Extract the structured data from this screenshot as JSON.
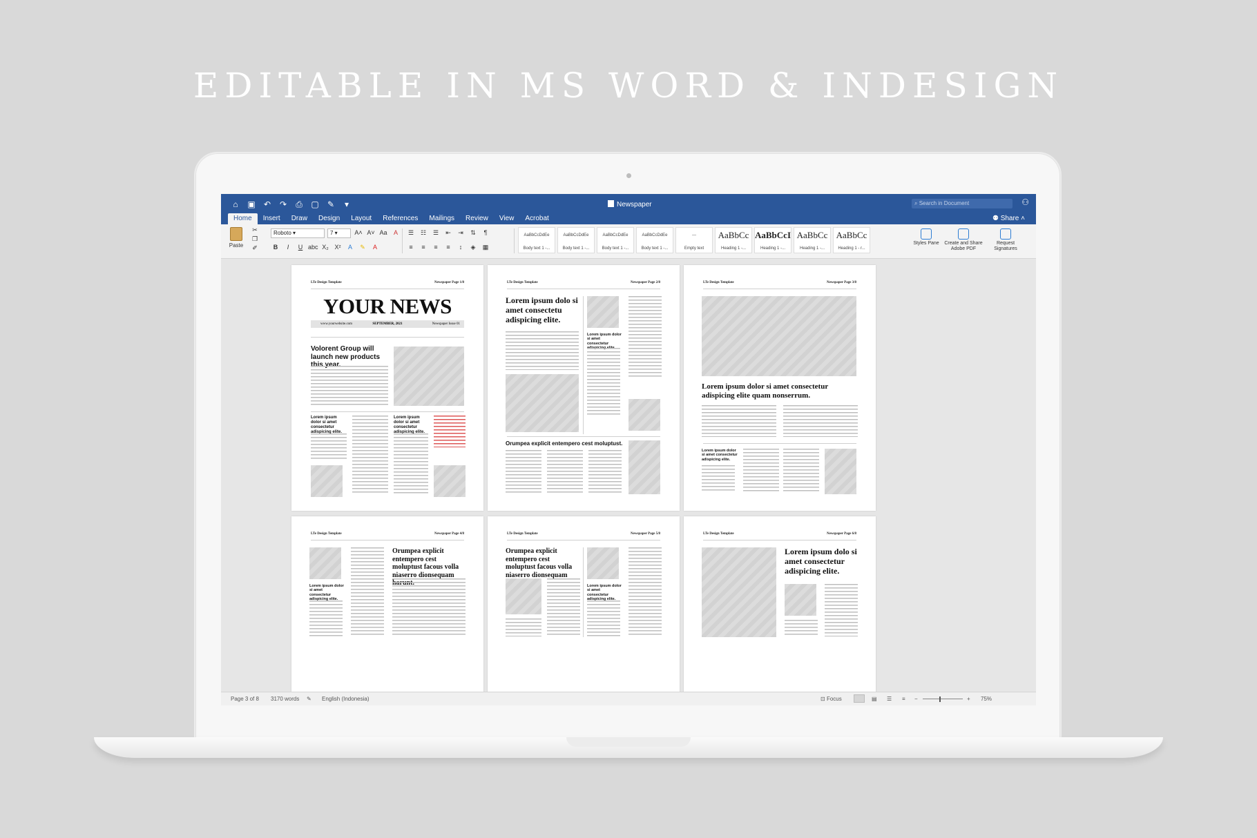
{
  "headline": "EDITABLE IN MS WORD & INDESIGN",
  "titlebar": {
    "title": "Newspaper",
    "search_placeholder": "Search in Document",
    "share": "Share",
    "quick_access": [
      "home-icon",
      "save-icon",
      "undo-icon",
      "redo-icon",
      "print-icon",
      "new-doc-icon",
      "edit-icon",
      "more-icon"
    ]
  },
  "tabs": [
    "Home",
    "Insert",
    "Draw",
    "Design",
    "Layout",
    "References",
    "Mailings",
    "Review",
    "View",
    "Acrobat"
  ],
  "ribbon": {
    "paste": "Paste",
    "font": "Roboto",
    "size": "7",
    "styles": [
      {
        "sample": "AaBbCcDdEe",
        "label": "Body text 1 -..."
      },
      {
        "sample": "AaBbCcDdEe",
        "label": "Body text 1 -..."
      },
      {
        "sample": "AaBbCcDdEe",
        "label": "Body text 1 -..."
      },
      {
        "sample": "AaBbCcDdEe",
        "label": "Body text 1 -..."
      },
      {
        "sample": "---",
        "label": "Empty text"
      },
      {
        "sample": "AaBbCc",
        "label": "Heading 1 -..."
      },
      {
        "sample": "AaBbCcI",
        "label": "Heading 1 -..."
      },
      {
        "sample": "AaBbCc",
        "label": "Heading 1 -..."
      },
      {
        "sample": "AaBbCc",
        "label": "Heading 1 - r..."
      }
    ],
    "styles_pane": "Styles Pane",
    "create_pdf": "Create and Share Adobe PDF",
    "request_sig": "Request Signatures"
  },
  "pages": {
    "brand": "LTe Design Template",
    "p1": {
      "label": "Newspaper Page 1/8",
      "masthead": "YOUR NEWS",
      "site": "www.yourwebsite.com",
      "date": "SEPTEMBER, 2021",
      "issue": "Newspaper Issue 01",
      "lead": "Volorent Group will launch new products this year.",
      "sub1": "Lorem ipsum dolor si amet consectetur adispicing elite.",
      "sub2": "Lorem ipsum dolor si amet consectetur adispicing elite."
    },
    "p2": {
      "label": "Newspaper Page 2/8",
      "lead": "Lorem ipsum dolo si amet consectetu adispicing elite.",
      "sub": "Lorem ipsum dolor si amet consectetur adispicing elite.",
      "story": "Orumpea explicit entempero cest moluptust."
    },
    "p3": {
      "label": "Newspaper Page 3/8",
      "lead": "Lorem ipsum dolor si amet consectetur adispicing elite quam nonserrum.",
      "sub": "Lorem ipsum dolor si amet consectetur adispicing elite."
    },
    "p4": {
      "label": "Newspaper Page 4/8",
      "lead": "Orumpea explicit entempero cest moluptust facous volla niaserro dionsequam harunt.",
      "sub": "Lorem ipsum dolor si amet consectetur adispicing elite."
    },
    "p5": {
      "label": "Newspaper Page 5/8",
      "lead": "Orumpea explicit entempero cest moluptust facous volla niaserro dionsequam harunt.",
      "sub": "Lorem ipsum dolor si amet consectetur adispicing elite."
    },
    "p6": {
      "label": "Newspaper Page 6/8",
      "lead": "Lorem ipsum dolo si amet consectetur adispicing elite."
    }
  },
  "status": {
    "page": "Page 3 of 8",
    "words": "3170 words",
    "language": "English (Indonesia)",
    "focus": "Focus",
    "zoom": "75%"
  }
}
